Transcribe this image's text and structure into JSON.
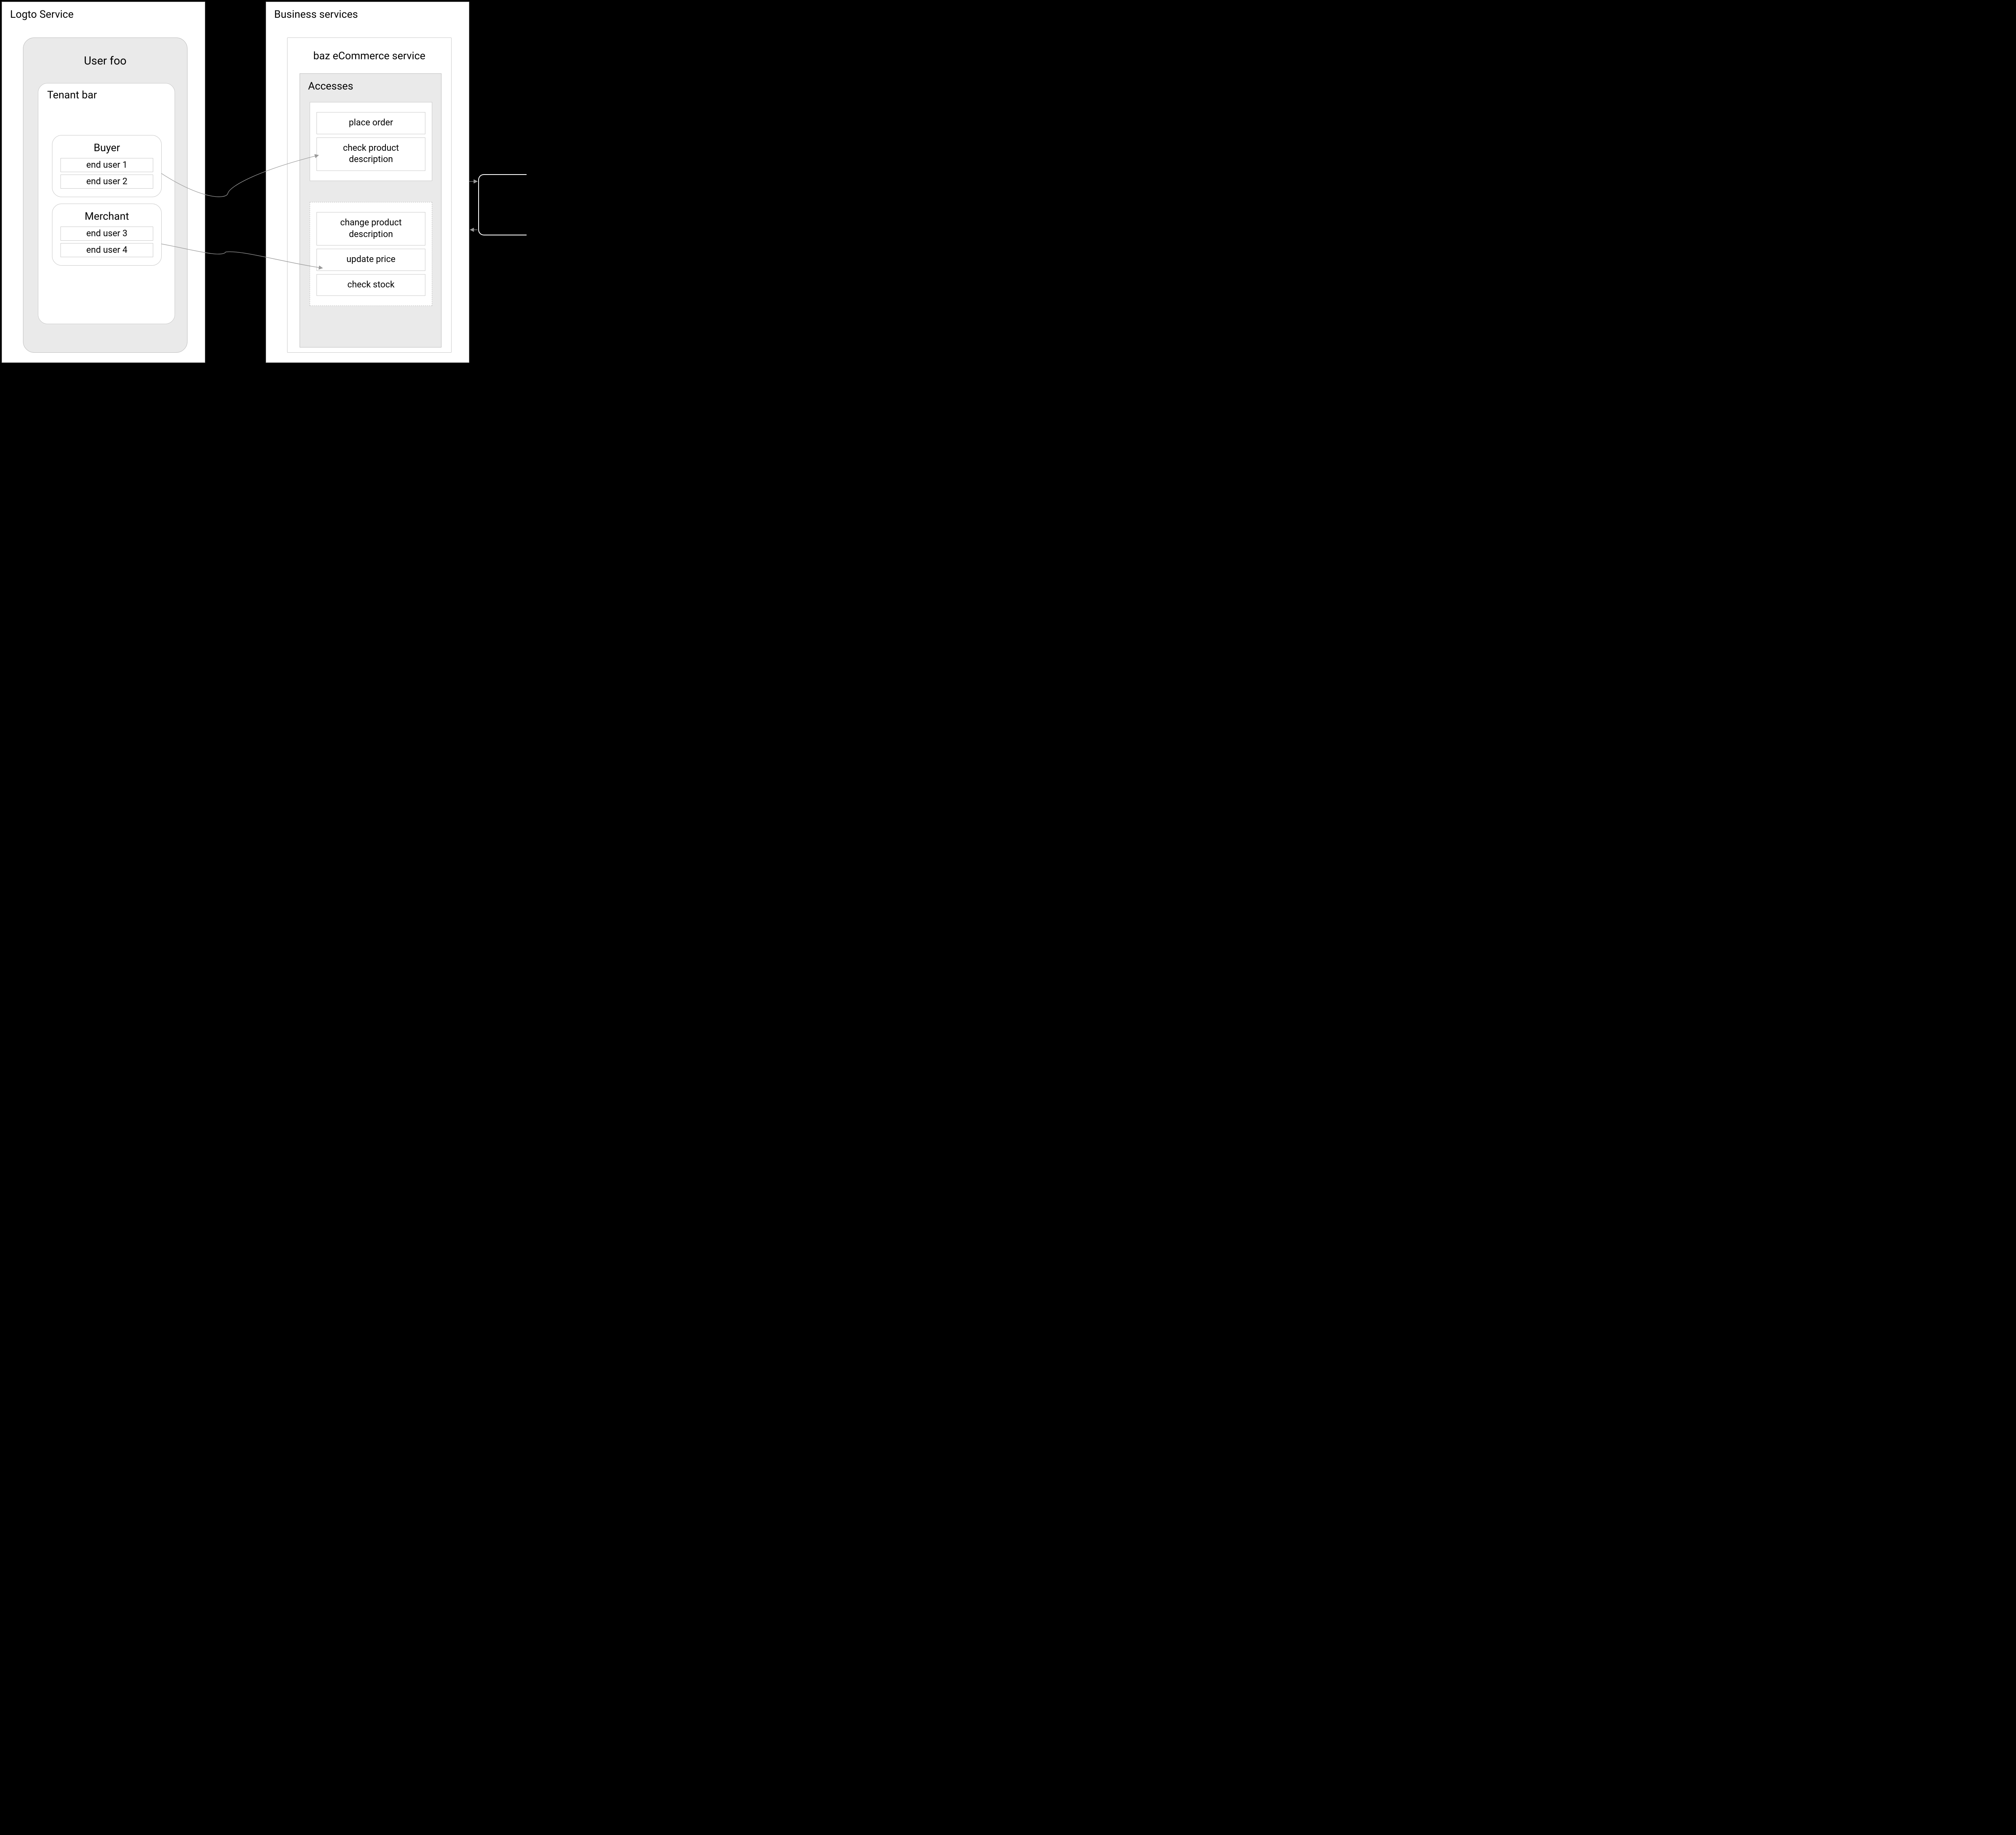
{
  "left_panel": {
    "title": "Logto Service",
    "user_box": {
      "title": "User foo",
      "tenant": {
        "title": "Tenant bar",
        "buyer": {
          "title": "Buyer",
          "users": [
            "end user 1",
            "end user 2"
          ]
        },
        "merchant": {
          "title": "Merchant",
          "users": [
            "end user 3",
            "end user 4"
          ]
        }
      }
    }
  },
  "right_panel": {
    "title": "Business services",
    "ecom": {
      "title": "baz eCommerce service",
      "accesses": {
        "title": "Accesses",
        "group1": [
          "place order",
          "check product description"
        ],
        "group2": [
          "change product description",
          "update price",
          "check stock"
        ]
      }
    }
  }
}
